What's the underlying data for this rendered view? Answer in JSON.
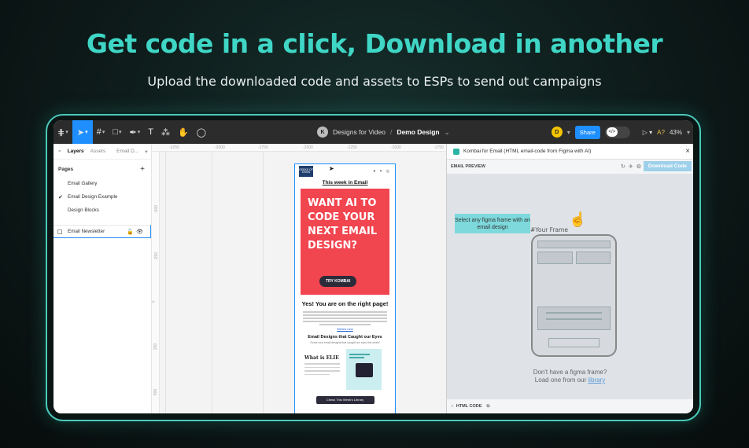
{
  "hero": {
    "title": "Get code in a click, Download in another",
    "subtitle": "Upload the downloaded code and assets to ESPs to send out campaigns"
  },
  "toolbar": {
    "breadcrumb_avatar": "K",
    "project": "Designs for Video",
    "separator": "/",
    "file": "Demo Design",
    "user_avatar": "D",
    "share_label": "Share",
    "dev_mode_icon": "</>",
    "zoom": "43%",
    "a11y": "A?"
  },
  "left_panel": {
    "tab_layers": "Layers",
    "tab_assets": "Assets",
    "file_name": "Email D...",
    "pages_heading": "Pages",
    "add_page": "+",
    "pages": [
      {
        "label": "Email Gallery",
        "checked": false
      },
      {
        "label": "Email Design Example",
        "checked": true
      },
      {
        "label": "Design Blocks",
        "checked": false
      }
    ],
    "layer": "Email Newsletter"
  },
  "canvas": {
    "ruler_top": [
      "-3250",
      "-3000",
      "-2750",
      "-2500",
      "-2250",
      "-2000",
      "-1750"
    ],
    "ruler_left": [
      "-500",
      "-250",
      "0",
      "250",
      "500"
    ]
  },
  "email": {
    "logo": "GEEKS OF DSGN",
    "social": "● ▾ ◎",
    "this_week": "This week in Email",
    "hero_text": "WANT AI TO CODE YOUR NEXT EMAIL DESIGN?",
    "cta": "TRY KOMBAI",
    "yes_heading": "Yes! You are on the right page!",
    "whats_new": "What's new",
    "designs_heading": "Email Designs that Caught our Eyes",
    "designs_sub": "Some cool email designs that caught our eyes this week!",
    "card1_title": "What is ELIE",
    "check_btn": "Check This Week's Library"
  },
  "right_panel": {
    "plugin_title": "Kombai for Email (HTML email-code from Figma with AI)",
    "close": "×",
    "preview_label": "EMAIL PREVIEW",
    "download_label": "Download Code",
    "your_frame": "#Your Frame",
    "select_prompt": "Select any figma frame with an email design",
    "no_frame_line1": "Don't have a figma frame?",
    "no_frame_line2": "Load one from our",
    "library_link": "library",
    "html_code": "HTML CODE"
  },
  "colors": {
    "accent_teal": "#3fd6c6",
    "figma_blue": "#1f8fff",
    "hero_red": "#f1454f"
  }
}
